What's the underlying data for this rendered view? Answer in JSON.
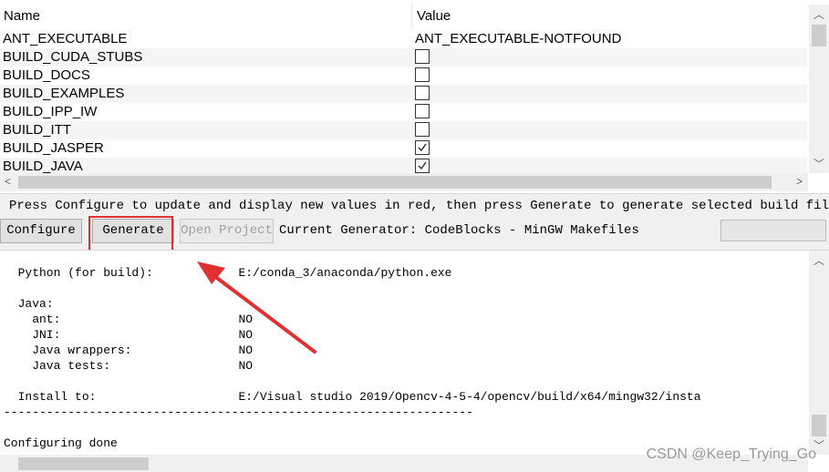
{
  "table": {
    "headers": {
      "name": "Name",
      "value": "Value"
    },
    "rows": [
      {
        "name": "ANT_EXECUTABLE",
        "type": "text",
        "value": "ANT_EXECUTABLE-NOTFOUND"
      },
      {
        "name": "BUILD_CUDA_STUBS",
        "type": "checkbox",
        "checked": false
      },
      {
        "name": "BUILD_DOCS",
        "type": "checkbox",
        "checked": false
      },
      {
        "name": "BUILD_EXAMPLES",
        "type": "checkbox",
        "checked": false
      },
      {
        "name": "BUILD_IPP_IW",
        "type": "checkbox",
        "checked": false
      },
      {
        "name": "BUILD_ITT",
        "type": "checkbox",
        "checked": false
      },
      {
        "name": "BUILD_JASPER",
        "type": "checkbox",
        "checked": true
      },
      {
        "name": "BUILD_JAVA",
        "type": "checkbox",
        "checked": true
      }
    ]
  },
  "info_text": "Press Configure to update and display new values in red, then press Generate to generate selected build files.",
  "buttons": {
    "configure": "Configure",
    "generate": "Generate",
    "open_project": "Open Project"
  },
  "generator_label": "Current Generator: CodeBlocks - MinGW Makefiles",
  "output_lines": [
    "  Python (for build):            E:/conda_3/anaconda/python.exe",
    "",
    "  Java:",
    "    ant:                         NO",
    "    JNI:                         NO",
    "    Java wrappers:               NO",
    "    Java tests:                  NO",
    "",
    "  Install to:                    E:/Visual studio 2019/Opencv-4-5-4/opencv/build/x64/mingw32/insta",
    "------------------------------------------------------------------",
    "",
    "Configuring done"
  ],
  "watermark": "CSDN @Keep_Trying_Go",
  "colors": {
    "highlight": "#e03030",
    "arrow": "#e03030"
  },
  "icons": {
    "scroll_up": "chevron-up-icon",
    "scroll_down": "chevron-down-icon",
    "scroll_left": "chevron-left-icon",
    "scroll_right": "chevron-right-icon"
  }
}
